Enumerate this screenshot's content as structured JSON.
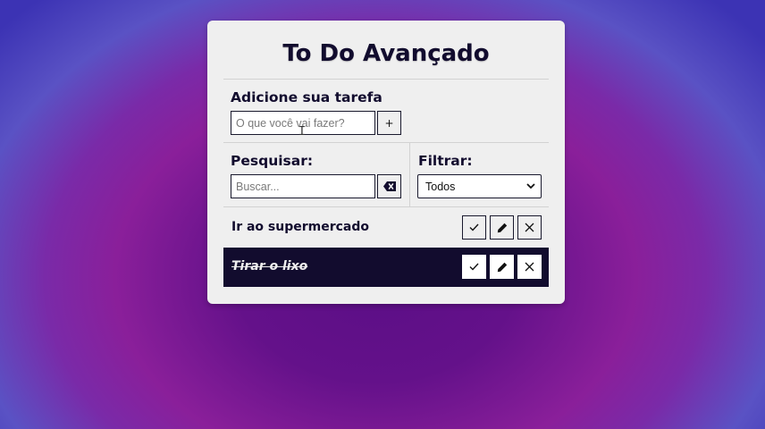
{
  "app": {
    "title": "To Do Avançado"
  },
  "add_section": {
    "label": "Adicione sua tarefa",
    "input_placeholder": "O que você vai fazer?",
    "add_button_label": "+"
  },
  "search_section": {
    "label": "Pesquisar:",
    "input_placeholder": "Buscar...",
    "clear_icon": "backspace-icon"
  },
  "filter_section": {
    "label": "Filtrar:",
    "selected": "Todos"
  },
  "todos": [
    {
      "title": "Ir ao supermercado",
      "done": false
    },
    {
      "title": "Tirar o lixo",
      "done": true
    }
  ],
  "action_icons": [
    "check-icon",
    "pencil-icon",
    "close-icon"
  ],
  "colors": {
    "dark": "#120c2e",
    "card": "#efefef",
    "background_center": "#5b0e86",
    "background_edge": "#3c33b4"
  }
}
